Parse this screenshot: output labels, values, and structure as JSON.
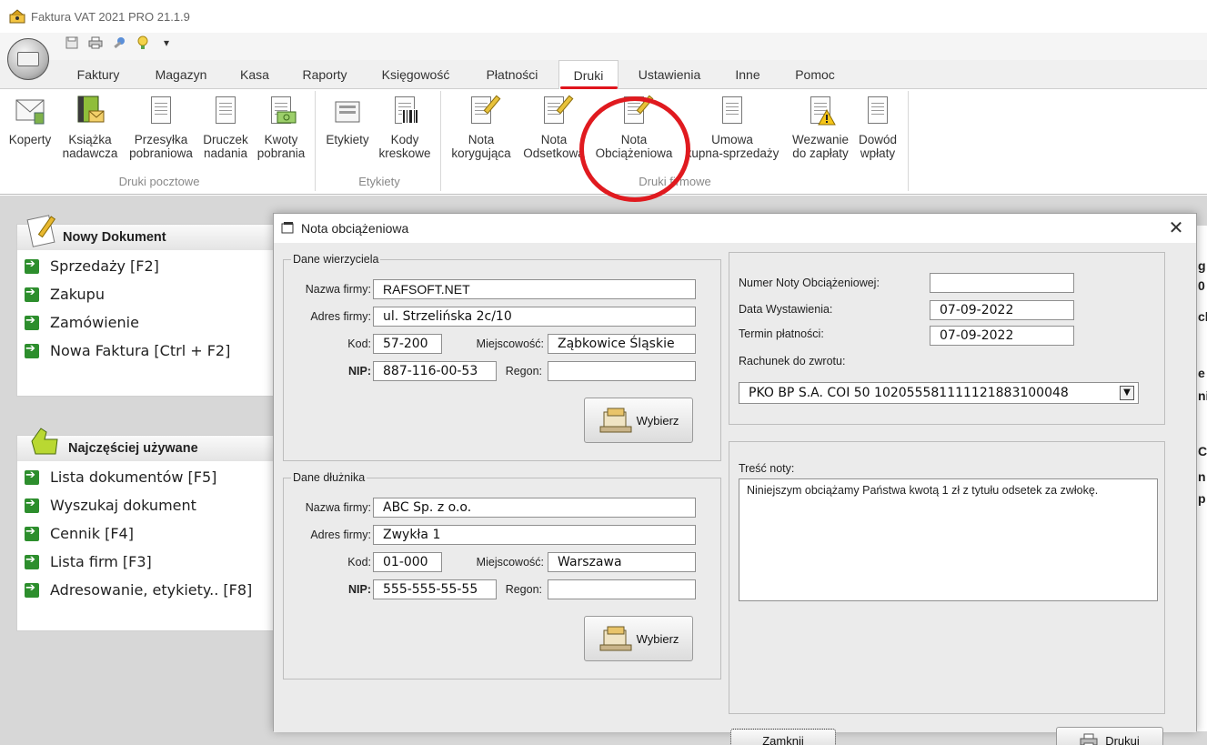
{
  "window": {
    "title": "Faktura VAT 2021 PRO 21.1.9"
  },
  "quick_access": {
    "icons": [
      "save-icon",
      "print-icon",
      "tools-icon",
      "bulb-icon",
      "dropdown-icon"
    ]
  },
  "tabs": [
    {
      "label": "Faktury"
    },
    {
      "label": "Magazyn"
    },
    {
      "label": "Kasa"
    },
    {
      "label": "Raporty"
    },
    {
      "label": "Księgowość"
    },
    {
      "label": "Płatności"
    },
    {
      "label": "Druki"
    },
    {
      "label": "Ustawienia"
    },
    {
      "label": "Inne"
    },
    {
      "label": "Pomoc"
    }
  ],
  "active_tab": "Druki",
  "ribbon": {
    "groups": [
      {
        "label": "Druki pocztowe"
      },
      {
        "label": "Etykiety"
      },
      {
        "label": "Druki firmowe"
      }
    ],
    "buttons": [
      {
        "line1": "Koperty",
        "line2": ""
      },
      {
        "line1": "Książka",
        "line2": "nadawcza"
      },
      {
        "line1": "Przesyłka",
        "line2": "pobraniowa"
      },
      {
        "line1": "Druczek",
        "line2": "nadania"
      },
      {
        "line1": "Kwoty",
        "line2": "pobrania"
      },
      {
        "line1": "Etykiety",
        "line2": ""
      },
      {
        "line1": "Kody",
        "line2": "kreskowe"
      },
      {
        "line1": "Nota",
        "line2": "korygująca"
      },
      {
        "line1": "Nota",
        "line2": "Odsetkowa"
      },
      {
        "line1": "Nota",
        "line2": "Obciążeniowa"
      },
      {
        "line1": "Umowa",
        "line2": "kupna-sprzedaży"
      },
      {
        "line1": "Wezwanie",
        "line2": "do zapłaty"
      },
      {
        "line1": "Dowód",
        "line2": "wpłaty"
      }
    ]
  },
  "sidebar": {
    "new_doc": {
      "title": "Nowy Dokument",
      "items": [
        "Sprzedaży [F2]",
        "Zakupu",
        "Zamówienie",
        "Nowa Faktura [Ctrl + F2]"
      ]
    },
    "frequent": {
      "title": "Najczęściej używane",
      "items": [
        "Lista dokumentów [F5]",
        "Wyszukaj dokument",
        "Cennik [F4]",
        "Lista firm [F3]",
        "Adresowanie, etykiety.. [F8]"
      ]
    }
  },
  "dialog": {
    "title": "Nota obciążeniowa",
    "creditor": {
      "legend": "Dane wierzyciela",
      "name_label": "Nazwa firmy:",
      "name": "RAFSOFT.NET",
      "address_label": "Adres firmy:",
      "address": "ul. Strzelińska 2c/10",
      "code_label": "Kod:",
      "code": "57-200",
      "city_label": "Miejscowość:",
      "city": "Ząbkowice Śląskie",
      "nip_label": "NIP:",
      "nip": "887-116-00-53",
      "regon_label": "Regon:",
      "regon": "",
      "select_button": "Wybierz"
    },
    "debtor": {
      "legend": "Dane dłużnika",
      "name_label": "Nazwa firmy:",
      "name": "ABC Sp. z o.o.",
      "address_label": "Adres firmy:",
      "address": "Zwykła 1",
      "code_label": "Kod:",
      "code": "01-000",
      "city_label": "Miejscowość:",
      "city": "Warszawa",
      "nip_label": "NIP:",
      "nip": "555-555-55-55",
      "regon_label": "Regon:",
      "regon": "",
      "select_button": "Wybierz"
    },
    "note": {
      "number_label": "Numer Noty Obciążeniowej:",
      "number": "",
      "issue_date_label": "Data Wystawienia:",
      "issue_date": "07-09-2022",
      "due_date_label": "Termin płatności:",
      "due_date": "07-09-2022",
      "account_label": "Rachunek do zwrotu:",
      "account": "PKO BP S.A. COI 50 1020555811111218831000​48",
      "content_label": "Treść noty:",
      "content": "Niniejszym obciążamy Państwa kwotą 1 zł z tytułu odsetek za zwłokę."
    },
    "buttons": {
      "close": "Zamknij",
      "print": "Drukuj"
    }
  },
  "right_edge_chars": [
    "g",
    "0",
    "cl",
    "e",
    "ni",
    "C",
    "n",
    "p"
  ],
  "colors": {
    "accent_red": "#e0141c",
    "green_arrow": "#2d8e2d"
  }
}
